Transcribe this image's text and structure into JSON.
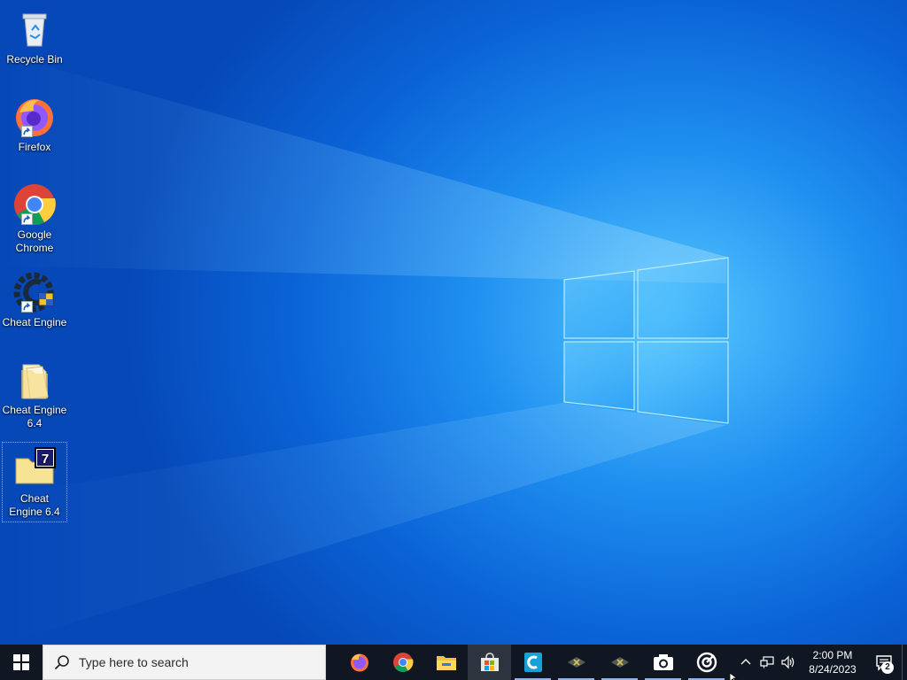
{
  "desktop": {
    "icons": [
      {
        "label": "Recycle Bin",
        "icon": "recycle-bin-icon"
      },
      {
        "label": "Firefox",
        "icon": "firefox-icon"
      },
      {
        "label": "Google Chrome",
        "icon": "chrome-icon"
      },
      {
        "label": "Cheat Engine",
        "icon": "cheat-engine-icon"
      },
      {
        "label": "Cheat Engine 6.4",
        "icon": "folder-icon"
      },
      {
        "label": "Cheat Engine 6.4",
        "icon": "7zip-archive-icon"
      }
    ]
  },
  "taskbar": {
    "search_placeholder": "Type here to search",
    "pinned_apps": [
      {
        "name": "Firefox",
        "icon": "firefox-icon"
      },
      {
        "name": "Google Chrome",
        "icon": "chrome-icon"
      },
      {
        "name": "File Explorer",
        "icon": "file-explorer-icon"
      },
      {
        "name": "Microsoft Store",
        "icon": "store-icon"
      },
      {
        "name": "Cheat Engine",
        "icon": "cheat-engine-c-icon"
      },
      {
        "name": "App",
        "icon": "app-x-icon"
      },
      {
        "name": "App",
        "icon": "app-x-icon"
      },
      {
        "name": "Camera",
        "icon": "camera-icon"
      },
      {
        "name": "Media",
        "icon": "media-icon"
      }
    ],
    "tray": {
      "time": "2:00 PM",
      "date": "8/24/2023",
      "notification_count": "2"
    }
  },
  "colors": {
    "taskbar_bg": "#101722",
    "accent_blue": "#0a63d6",
    "search_bg": "#f3f3f3"
  }
}
